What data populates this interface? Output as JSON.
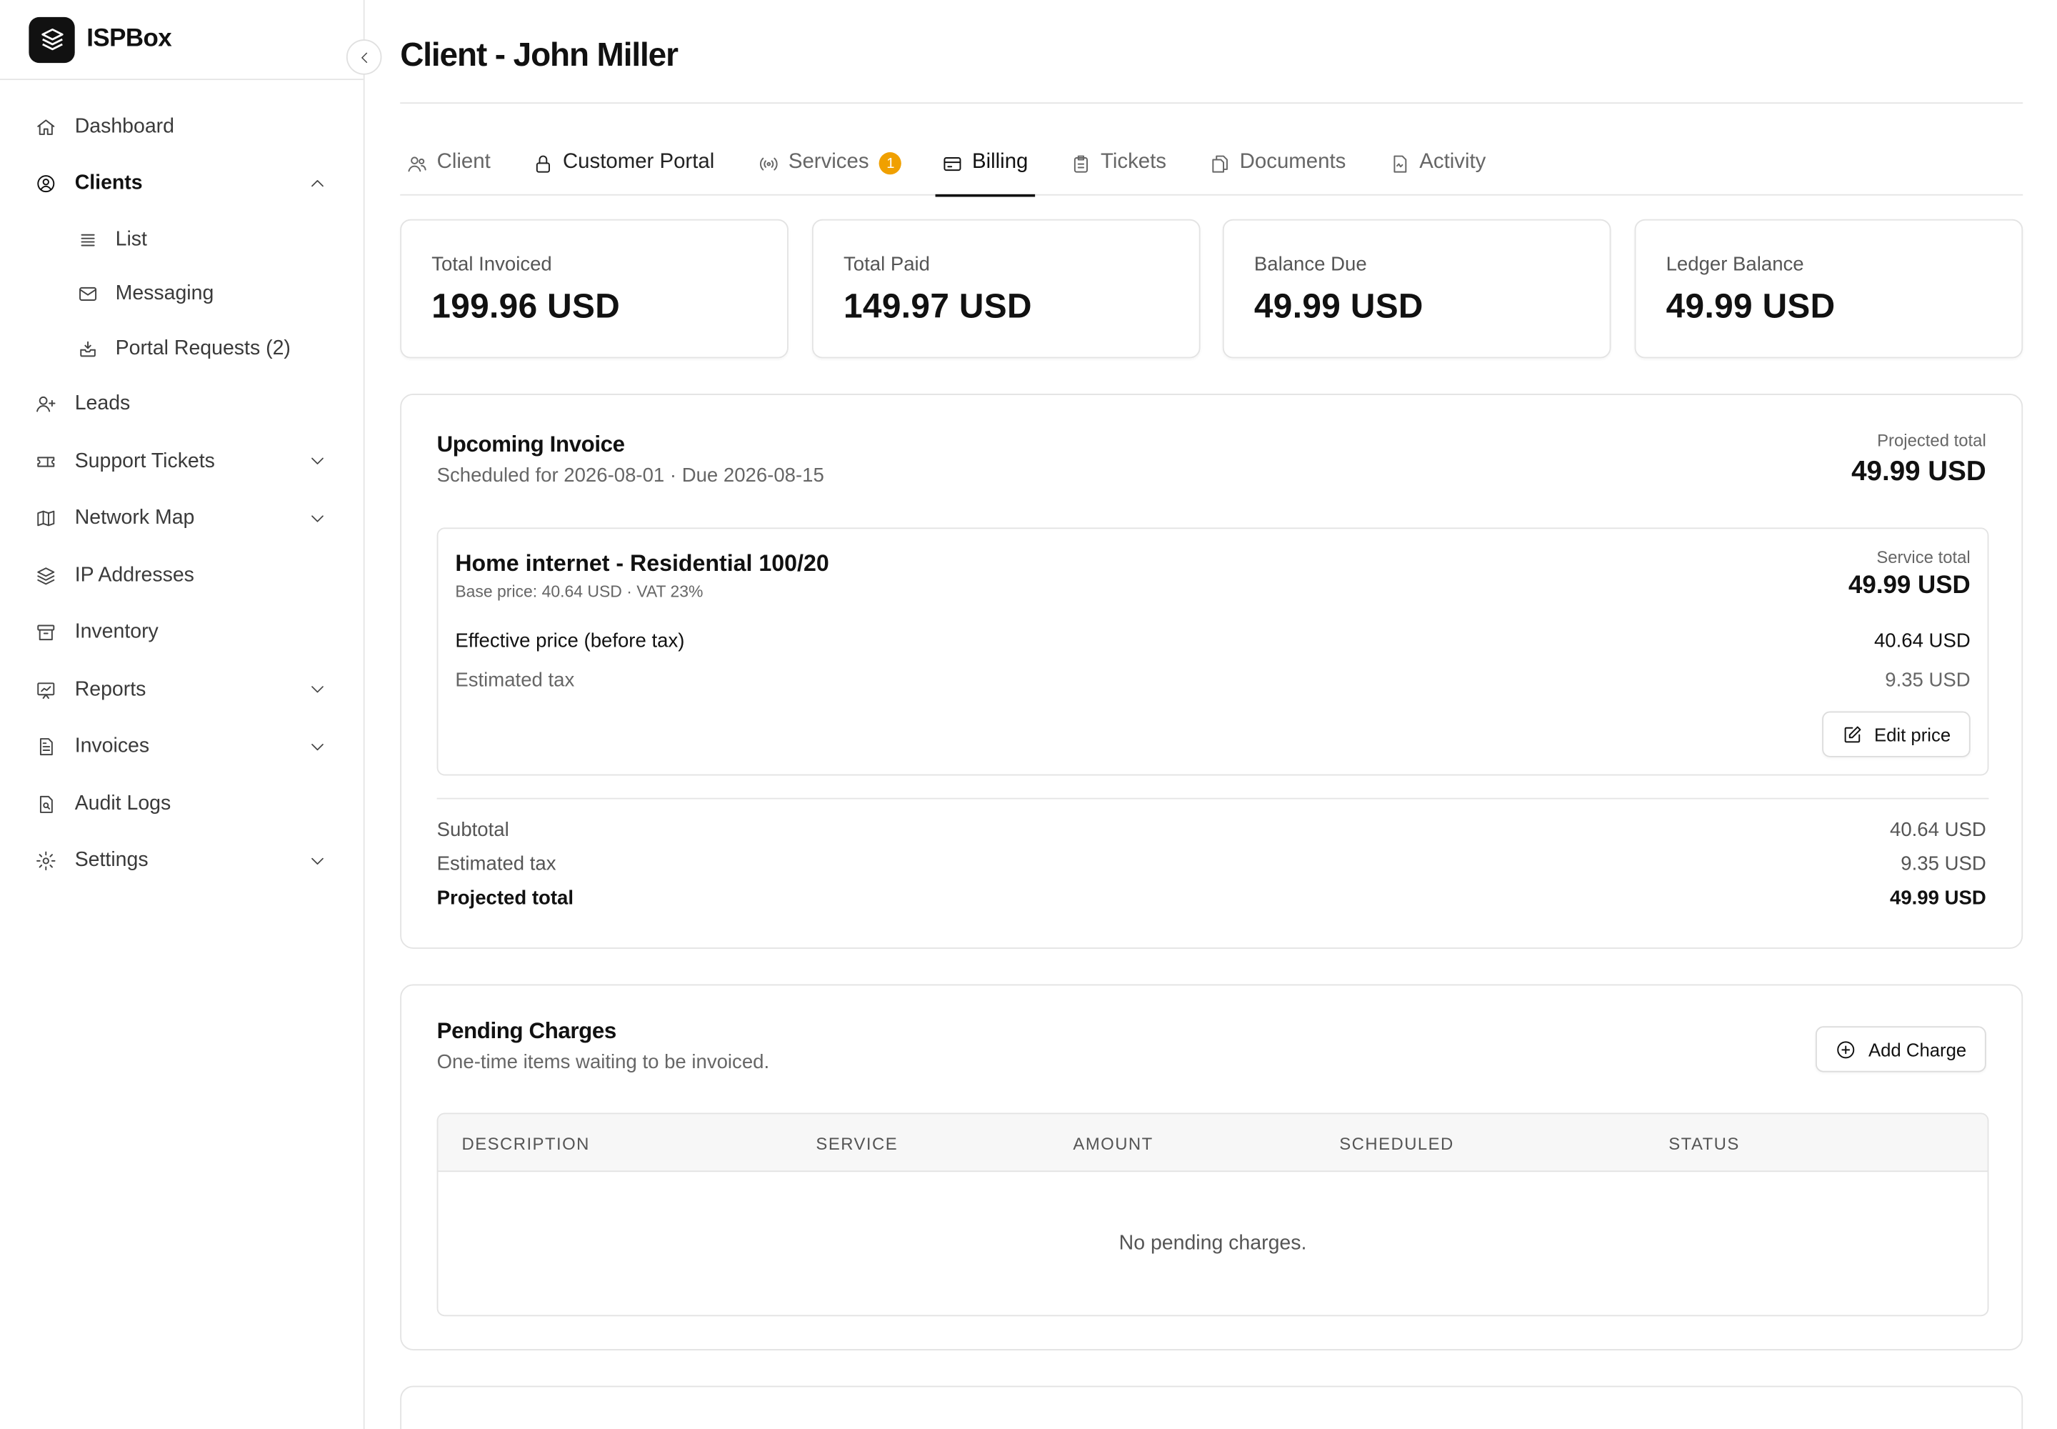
{
  "app": {
    "name": "ISPBox"
  },
  "sidebar": {
    "items": [
      {
        "label": "Dashboard"
      },
      {
        "label": "Clients"
      },
      {
        "label": "List"
      },
      {
        "label": "Messaging"
      },
      {
        "label": "Portal Requests (2)"
      },
      {
        "label": "Leads"
      },
      {
        "label": "Support Tickets"
      },
      {
        "label": "Network Map"
      },
      {
        "label": "IP Addresses"
      },
      {
        "label": "Inventory"
      },
      {
        "label": "Reports"
      },
      {
        "label": "Invoices"
      },
      {
        "label": "Audit Logs"
      },
      {
        "label": "Settings"
      }
    ]
  },
  "page": {
    "title": "Client - John Miller"
  },
  "tabs": [
    {
      "label": "Client"
    },
    {
      "label": "Customer Portal"
    },
    {
      "label": "Services",
      "badge": "1"
    },
    {
      "label": "Billing"
    },
    {
      "label": "Tickets"
    },
    {
      "label": "Documents"
    },
    {
      "label": "Activity"
    }
  ],
  "stats": [
    {
      "label": "Total Invoiced",
      "value": "199.96 USD"
    },
    {
      "label": "Total Paid",
      "value": "149.97 USD"
    },
    {
      "label": "Balance Due",
      "value": "49.99 USD"
    },
    {
      "label": "Ledger Balance",
      "value": "49.99 USD"
    }
  ],
  "upcoming": {
    "title": "Upcoming Invoice",
    "subtitle": "Scheduled for 2026-08-01 · Due 2026-08-15",
    "projected_label": "Projected total",
    "projected_value": "49.99 USD",
    "service": {
      "name": "Home internet - Residential 100/20",
      "meta": "Base price: 40.64 USD · VAT 23%",
      "total_label": "Service total",
      "total_value": "49.99 USD",
      "effective_label": "Effective price (before tax)",
      "effective_value": "40.64 USD",
      "tax_label": "Estimated tax",
      "tax_value": "9.35 USD",
      "edit_label": "Edit price"
    },
    "summary": {
      "subtotal_label": "Subtotal",
      "subtotal_value": "40.64 USD",
      "tax_label": "Estimated tax",
      "tax_value": "9.35 USD",
      "total_label": "Projected total",
      "total_value": "49.99 USD"
    }
  },
  "pending": {
    "title": "Pending Charges",
    "subtitle": "One-time items waiting to be invoiced.",
    "add_label": "Add Charge",
    "columns": [
      "DESCRIPTION",
      "SERVICE",
      "AMOUNT",
      "SCHEDULED",
      "STATUS"
    ],
    "empty_text": "No pending charges."
  },
  "colors": {
    "accent": "#111111",
    "badge": "#f0a000",
    "border": "#e3e3e3"
  }
}
